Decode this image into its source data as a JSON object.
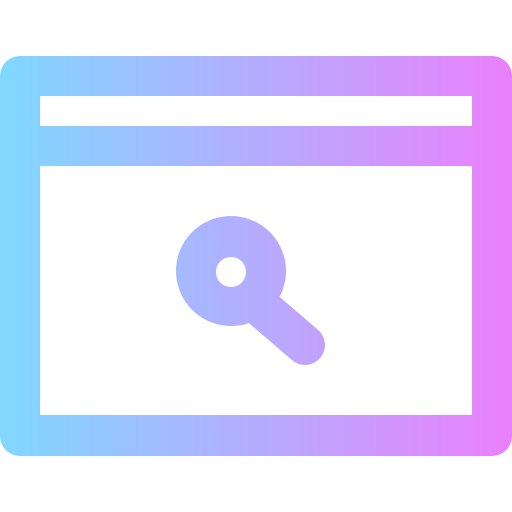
{
  "icon": {
    "name": "browser-search-icon",
    "gradient": {
      "start": "#80d8ff",
      "end": "#ea80fc"
    },
    "background": "#ffffff"
  }
}
